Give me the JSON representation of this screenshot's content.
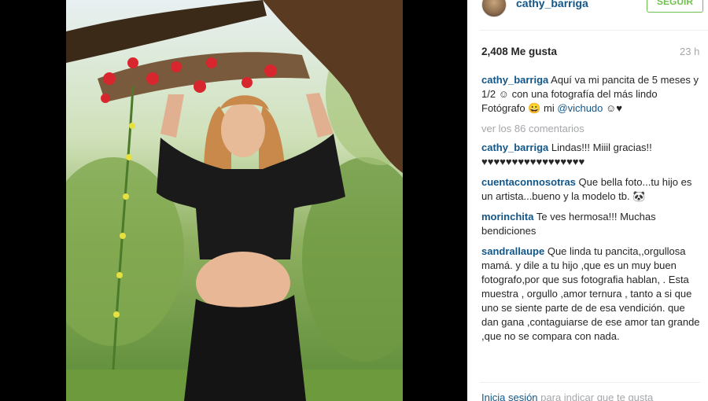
{
  "post": {
    "username": "cathy_barriga",
    "follow_label": "SEGUIR",
    "likes": "2,408 Me gusta",
    "time_ago": "23 h"
  },
  "caption": {
    "username": "cathy_barriga",
    "text_part1": "Aquí va mi pancita de 5 meses y 1/2 ☺ con una fotografía del más lindo Fotógrafo 😀 mi ",
    "mention": "@vichudo",
    "text_part2": " ☺♥"
  },
  "view_all_comments": "ver los 86 comentarios",
  "comments": [
    {
      "username": "cathy_barriga",
      "text": "Lindas!!! Miiil gracias!! ♥♥♥♥♥♥♥♥♥♥♥♥♥♥♥♥♥"
    },
    {
      "username": "cuentaconnosotras",
      "text": "Que bella foto...tu hijo es un artista...bueno y la modelo tb. 🐼"
    },
    {
      "username": "morinchita",
      "text": "Te ves hermosa!!! Muchas bendiciones"
    },
    {
      "username": "sandrallaupe",
      "text": "Que linda tu pancita,,orgullosa mamá. y dile a tu hijo ,que es un muy buen fotografo,por que sus fotografia hablan, . Esta muestra , orgullo ,amor ternura , tanto a si que uno se siente parte de de esa vendición. que dan gana ,contaguiarse de ese amor tan grande ,que no se compara con nada."
    }
  ],
  "footer": {
    "login_link": "Inicia sesión",
    "login_text": " para indicar que te gusta"
  },
  "colors": {
    "link_blue": "#125688",
    "muted_gray": "#a5a7aa",
    "follow_green": "#70c050"
  }
}
